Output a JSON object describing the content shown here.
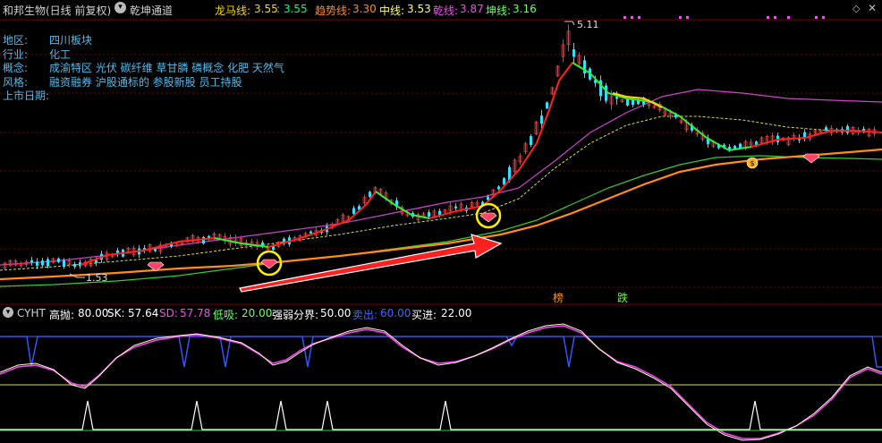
{
  "header": {
    "stock_title": "和邦生物(日线 前复权)",
    "indicator_name": "乾坤通道",
    "ma_items": [
      {
        "label": "龙马线:",
        "value": "3.55",
        "value2": ": 3.55",
        "color": "#ffd700",
        "color2": "#00ff7f"
      },
      {
        "label": "趋势线:",
        "value": "3.30",
        "color": "#ff8c1a"
      },
      {
        "label": "中线:",
        "value": "3.53",
        "color": "#ffff66"
      },
      {
        "label": "乾线:",
        "value": "3.87",
        "color": "#ff44ff"
      },
      {
        "label": "坤线:",
        "value": "3.16",
        "color": "#66ff66"
      }
    ]
  },
  "info": {
    "rows": [
      {
        "key": "地区:",
        "value": "四川板块"
      },
      {
        "key": "行业:",
        "value": "化工"
      },
      {
        "key": "概念:",
        "value": "成渝特区 光伏 碳纤维 草甘膦 磷概念 化肥 天然气"
      },
      {
        "key": "风格:",
        "value": "融资融券 沪股通标的 参股新股 员工持股"
      },
      {
        "key": "上市日期:",
        "value": ""
      }
    ]
  },
  "chart": {
    "high_label": "5.11",
    "low_label": "1.53",
    "markers": [
      "榜",
      "跌"
    ]
  },
  "oscillator": {
    "name": "CYHT",
    "items": [
      {
        "label": "高抛:",
        "value": "80.00",
        "color": "#ffffff"
      },
      {
        "label": "SK:",
        "value": "57.64",
        "color": "#ffffff"
      },
      {
        "label": "SD:",
        "value": "57.78",
        "color": "#ff44ff"
      },
      {
        "label": "低吸:",
        "value": "20.00",
        "color": "#66ff66"
      },
      {
        "label": "强弱分界:",
        "value": "50.00",
        "color": "#ffffff"
      },
      {
        "label": "卖出:",
        "value": "60.00",
        "color": "#4466ff"
      },
      {
        "label": "买进:",
        "value": "22.00",
        "color": "#ffffff"
      }
    ]
  },
  "colors": {
    "up_candle": "#ff3030",
    "down_candle": "#30e0ff",
    "grid": "#7a0000",
    "longma_line": "#ffd700",
    "trend_line": "#ff8c1a",
    "qian_line": "#ff44ff",
    "kun_line": "#66ff66"
  }
}
